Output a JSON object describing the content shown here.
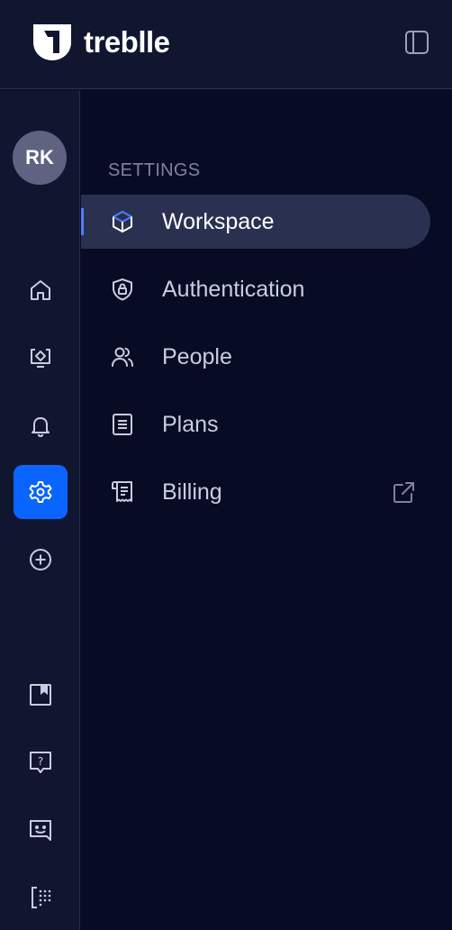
{
  "brand": {
    "name": "treblle"
  },
  "user": {
    "initials": "RK"
  },
  "rail": {
    "items": [
      {
        "id": "home",
        "icon": "home-icon"
      },
      {
        "id": "api",
        "icon": "api-monitor-icon"
      },
      {
        "id": "alerts",
        "icon": "bell-icon"
      },
      {
        "id": "settings",
        "icon": "gear-icon",
        "active": true
      },
      {
        "id": "add",
        "icon": "plus-circle-icon"
      },
      {
        "id": "bookmark",
        "icon": "bookmark-icon"
      },
      {
        "id": "help",
        "icon": "help-icon"
      },
      {
        "id": "feedback",
        "icon": "chat-icon"
      },
      {
        "id": "apps",
        "icon": "grid-icon"
      }
    ]
  },
  "settings": {
    "heading": "SETTINGS",
    "items": [
      {
        "label": "Workspace",
        "icon": "cube-icon",
        "active": true
      },
      {
        "label": "Authentication",
        "icon": "shield-lock-icon"
      },
      {
        "label": "People",
        "icon": "users-icon"
      },
      {
        "label": "Plans",
        "icon": "document-icon"
      },
      {
        "label": "Billing",
        "icon": "receipt-icon",
        "external": true
      }
    ]
  },
  "colors": {
    "accent": "#0a64ff",
    "background": "#070b23",
    "panel": "#111630",
    "active_item": "#2a3150"
  }
}
